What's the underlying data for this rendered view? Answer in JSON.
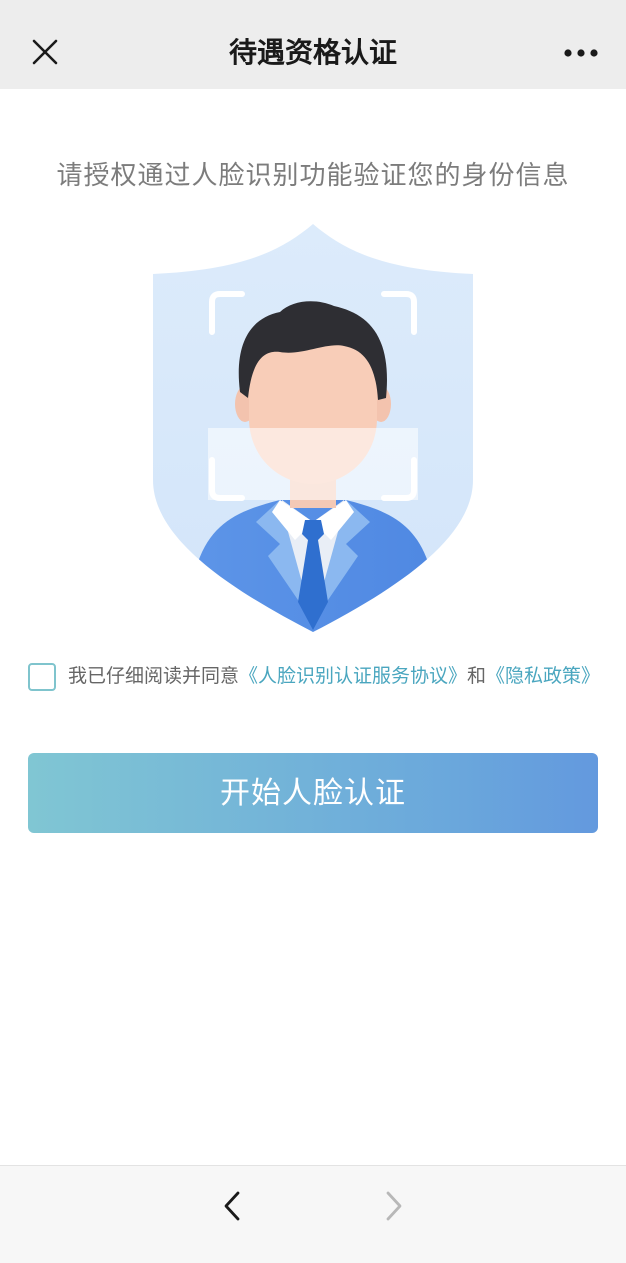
{
  "navbar": {
    "title": "待遇资格认证",
    "close_icon": "close-icon",
    "more_icon": "more-dots-icon"
  },
  "main": {
    "subtitle": "请授权通过人脸识别功能验证您的身份信息",
    "illustration_icon": "face-recognition-shield-icon"
  },
  "agreement": {
    "checked": false,
    "prefix": "我已仔细阅读并同意",
    "link_1": "《人脸识别认证服务协议》",
    "conjunction": "和",
    "link_2": "《隐私政策》"
  },
  "actions": {
    "start_label": "开始人脸认证"
  },
  "bottom_bar": {
    "back_icon": "chevron-left-icon",
    "forward_icon": "chevron-right-icon"
  },
  "colors": {
    "nav_bg": "#ededed",
    "link": "#4aa6bf",
    "checkbox_border": "#7fc4cd",
    "button_gradient_start": "#80c6d3",
    "button_gradient_end": "#6399de",
    "shield": "#d9e9fb"
  }
}
